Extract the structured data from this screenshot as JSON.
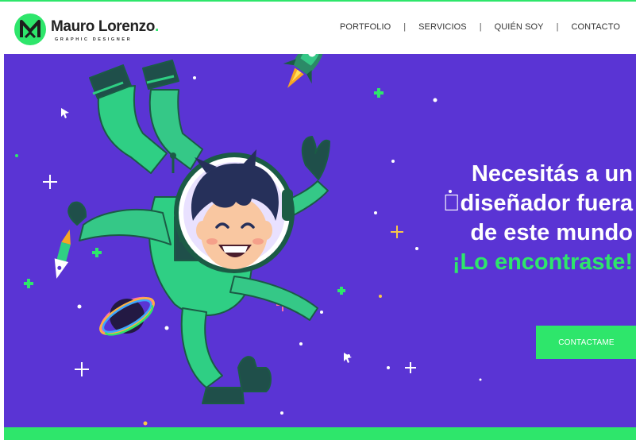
{
  "brand": {
    "name": "Mauro Lorenzo",
    "dot": ".",
    "tagline": "GRAPHIC DESIGNER",
    "accent": "#2ee66b"
  },
  "nav": {
    "items": [
      {
        "label": "PORTFOLIO"
      },
      {
        "label": "SERVICIOS"
      },
      {
        "label": "QUIÉN SOY"
      },
      {
        "label": "CONTACTO"
      }
    ],
    "separator": "|"
  },
  "hero": {
    "background": "#5a34d4",
    "headline_lines": [
      "Necesitás a un",
      "\u0000diseñador fuera",
      "de este mundo"
    ],
    "highlight": "¡Lo encontraste!",
    "cta_label": "CONTACTAME",
    "illustration": "astronaut-illustration"
  }
}
